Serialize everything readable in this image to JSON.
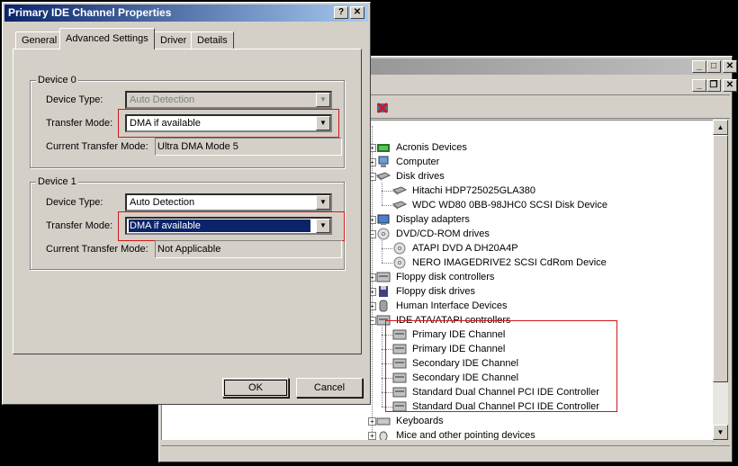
{
  "dialog": {
    "title": "Primary IDE Channel Properties",
    "help_glyph": "?",
    "close_glyph": "✕",
    "tabs": [
      {
        "label": "General"
      },
      {
        "label": "Advanced Settings"
      },
      {
        "label": "Driver"
      },
      {
        "label": "Details"
      }
    ],
    "active_tab": "Advanced Settings",
    "device0": {
      "title": "Device 0",
      "device_type_label": "Device Type:",
      "device_type_value": "Auto Detection",
      "transfer_mode_label": "Transfer Mode:",
      "transfer_mode_value": "DMA if available",
      "current_mode_label": "Current Transfer Mode:",
      "current_mode_value": "Ultra DMA Mode 5"
    },
    "device1": {
      "title": "Device 1",
      "device_type_label": "Device Type:",
      "device_type_value": "Auto Detection",
      "transfer_mode_label": "Transfer Mode:",
      "transfer_mode_value": "DMA if available",
      "current_mode_label": "Current Transfer Mode:",
      "current_mode_value": "Not Applicable"
    },
    "ok_label": "OK",
    "cancel_label": "Cancel"
  },
  "device_manager": {
    "caption_buttons": {
      "minimize": "_",
      "maximize": "□",
      "close": "✕",
      "restore": "❐"
    },
    "tree": [
      {
        "label": "Acronis Devices",
        "icon": "acronis-icon",
        "level": 1,
        "expander": "+"
      },
      {
        "label": "Computer",
        "icon": "computer-icon",
        "level": 1,
        "expander": "+"
      },
      {
        "label": "Disk drives",
        "icon": "disk-drive-icon",
        "level": 1,
        "expander": "−"
      },
      {
        "label": "Hitachi HDP725025GLA380",
        "icon": "disk-drive-icon",
        "level": 2
      },
      {
        "label": "WDC WD80 0BB-98JHC0 SCSI Disk Device",
        "icon": "disk-drive-icon",
        "level": 2
      },
      {
        "label": "Display adapters",
        "icon": "display-adapter-icon",
        "level": 1,
        "expander": "+"
      },
      {
        "label": "DVD/CD-ROM drives",
        "icon": "cdrom-icon",
        "level": 1,
        "expander": "−"
      },
      {
        "label": "ATAPI DVD A  DH20A4P",
        "icon": "cdrom-icon",
        "level": 2
      },
      {
        "label": "NERO IMAGEDRIVE2 SCSI CdRom Device",
        "icon": "cdrom-icon",
        "level": 2
      },
      {
        "label": "Floppy disk controllers",
        "icon": "controller-icon",
        "level": 1,
        "expander": "+"
      },
      {
        "label": "Floppy disk drives",
        "icon": "floppy-icon",
        "level": 1,
        "expander": "+"
      },
      {
        "label": "Human Interface Devices",
        "icon": "hid-icon",
        "level": 1,
        "expander": "+"
      },
      {
        "label": "IDE ATA/ATAPI controllers",
        "icon": "controller-icon",
        "level": 1,
        "expander": "−"
      },
      {
        "label": "Primary IDE Channel",
        "icon": "controller-icon",
        "level": 2
      },
      {
        "label": "Primary IDE Channel",
        "icon": "controller-icon",
        "level": 2
      },
      {
        "label": "Secondary IDE Channel",
        "icon": "controller-icon",
        "level": 2
      },
      {
        "label": "Secondary IDE Channel",
        "icon": "controller-icon",
        "level": 2
      },
      {
        "label": "Standard Dual Channel PCI IDE Controller",
        "icon": "controller-icon",
        "level": 2
      },
      {
        "label": "Standard Dual Channel PCI IDE Controller",
        "icon": "controller-icon",
        "level": 2
      },
      {
        "label": "Keyboards",
        "icon": "keyboard-icon",
        "level": 1,
        "expander": "+"
      },
      {
        "label": "Mice and other pointing devices",
        "icon": "mouse-icon",
        "level": 1,
        "expander": "+"
      }
    ]
  },
  "colors": {
    "highlight_box": "#d01818",
    "selection": "#0a246a",
    "face": "#d4d0c8"
  }
}
